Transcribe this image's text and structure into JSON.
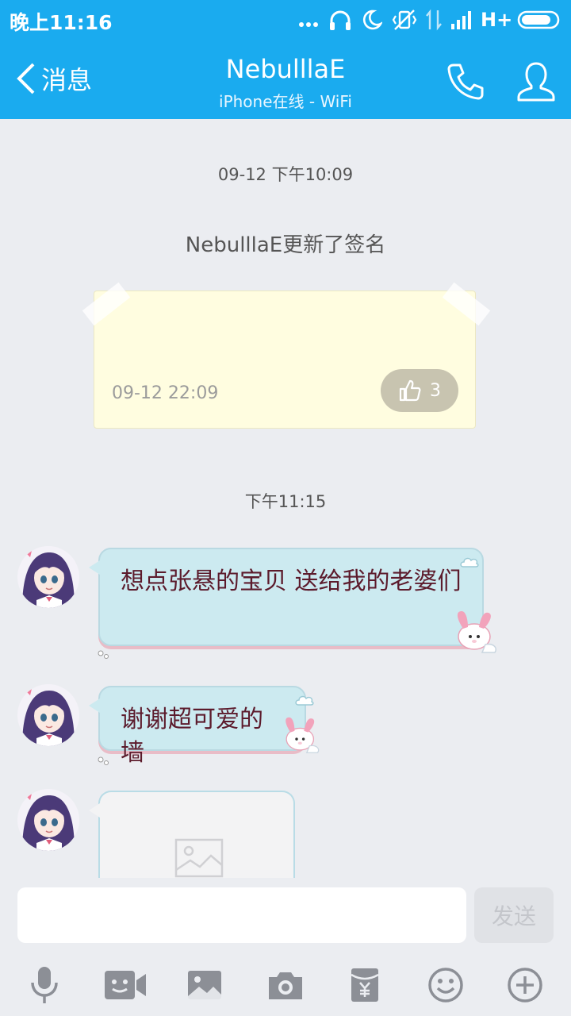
{
  "status_bar": {
    "time": "晚上11:16",
    "network": "H+",
    "icons": [
      "more-dots-icon",
      "headphones-icon",
      "moon-icon",
      "vibrate-off-icon",
      "data-arrows-icon",
      "signal-icon",
      "battery-icon"
    ]
  },
  "header": {
    "back_label": "消息",
    "title": "NebulllaE",
    "subtitle": "iPhone在线 - WiFi",
    "icons": [
      "phone-icon",
      "contact-icon"
    ]
  },
  "chat": {
    "timestamp_1": "09-12 下午10:09",
    "system_message": "NebulllaE更新了签名",
    "signature_card": {
      "date": "09-12 22:09",
      "like_count": "3"
    },
    "timestamp_2": "下午11:15",
    "messages": [
      {
        "text": "想点张悬的宝贝 送给我的老婆们"
      },
      {
        "text": "谢谢超可爱的墙"
      },
      {
        "type": "image-placeholder"
      }
    ]
  },
  "input": {
    "placeholder": "",
    "send_label": "发送"
  },
  "toolbar": {
    "icons": [
      "microphone-icon",
      "video-icon",
      "image-icon",
      "camera-icon",
      "red-packet-icon",
      "emoji-icon",
      "plus-icon"
    ]
  },
  "colors": {
    "header_blue": "#1aabef",
    "bubble_blue": "#cceaf0",
    "bubble_text": "#5c1b2c",
    "background": "#ebedf1"
  }
}
